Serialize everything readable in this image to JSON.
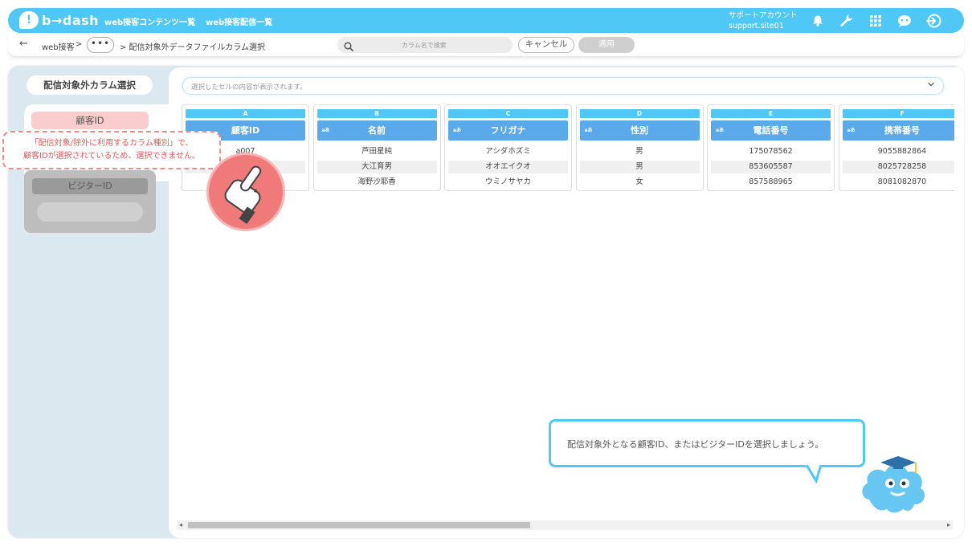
{
  "app": {
    "logo_text": "b→dash",
    "logo_mark": "!"
  },
  "topnav": {
    "contents": "web接客コンテンツ一覧",
    "delivery": "web接客配信一覧"
  },
  "account": {
    "role": "サポートアカウント",
    "site": "support.site01"
  },
  "topbar_icons": [
    "bell-icon",
    "wrench-icon",
    "apps-grid-icon",
    "chat-bot-icon",
    "logout-icon"
  ],
  "breadcrumb": {
    "back": "←",
    "root": "web接客",
    "sep1": ">",
    "more": "•••",
    "current": "> 配信対象外データファイルカラム選択"
  },
  "search": {
    "placeholder": "カラム名で検索"
  },
  "buttons": {
    "cancel": "キャンセル",
    "apply": "適用"
  },
  "sidebar": {
    "title": "配信対象外カラム選択",
    "customer_id": "顧客ID",
    "visitor_id": "ビジターID"
  },
  "cell_input": {
    "placeholder": "選択したセルの内容が表示されます。"
  },
  "columns": [
    {
      "letter": "A",
      "type": "",
      "header": "顧客ID",
      "cells": [
        "a007",
        "",
        ""
      ]
    },
    {
      "letter": "B",
      "type": "aあ",
      "header": "名前",
      "cells": [
        "芦田星純",
        "大江育男",
        "海野沙耶香"
      ]
    },
    {
      "letter": "C",
      "type": "aあ",
      "header": "フリガナ",
      "cells": [
        "アシダホズミ",
        "オオエイクオ",
        "ウミノサヤカ"
      ]
    },
    {
      "letter": "D",
      "type": "aあ",
      "header": "性別",
      "cells": [
        "男",
        "男",
        "女"
      ]
    },
    {
      "letter": "E",
      "type": "aあ",
      "header": "電話番号",
      "cells": [
        "175078562",
        "853605587",
        "857588965"
      ]
    },
    {
      "letter": "F",
      "type": "aあ",
      "header": "携帯番号",
      "cells": [
        "9055882864",
        "8025728258",
        "8081082870"
      ]
    }
  ],
  "warning": {
    "line1": "「配信対象/除外に利用するカラム種別」で、",
    "line2": "顧客IDが選択されているため、選択できません。"
  },
  "tip": "配信対象外となる顧客ID、またはビジターIDを選択しましょう。",
  "scrollbar": {
    "left_arrow": "◂",
    "right_arrow": "▸"
  },
  "colors": {
    "brand": "#4fc8f5",
    "header_blue": "#5aa9ea",
    "warning": "#e05a5a",
    "customer_chip": "#f9cdcd"
  }
}
